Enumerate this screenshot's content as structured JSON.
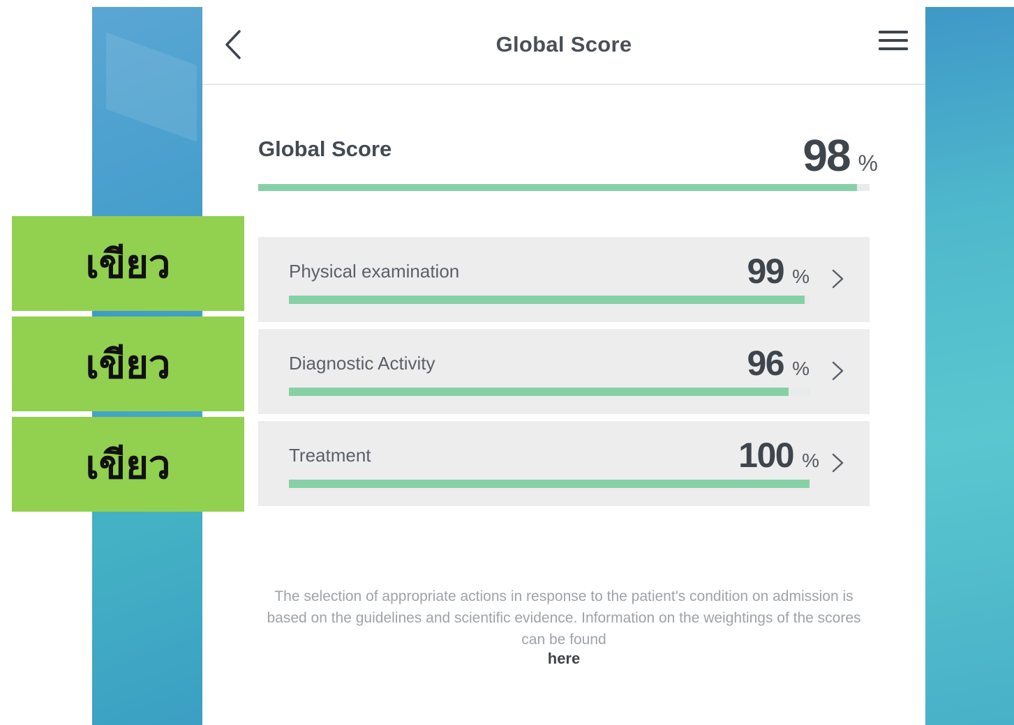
{
  "header": {
    "title": "Global Score",
    "back_icon": "chevron-left-icon",
    "menu_icon": "hamburger-menu-icon"
  },
  "global_score": {
    "label": "Global Score",
    "value": "98",
    "unit": "%",
    "progress_percent": 98
  },
  "categories": [
    {
      "label": "Physical examination",
      "value": "99",
      "unit": "%",
      "progress_percent": 99
    },
    {
      "label": "Diagnostic Activity",
      "value": "96",
      "unit": "%",
      "progress_percent": 96
    },
    {
      "label": "Treatment",
      "value": "100",
      "unit": "%",
      "progress_percent": 100
    }
  ],
  "footer": {
    "note": "The selection of appropriate actions in response to the patient's condition on admission is based on the guidelines and scientific evidence. Information on the weightings of the scores can be found",
    "link_label": "here"
  },
  "overlay_tags": [
    {
      "text": "เขียว"
    },
    {
      "text": "เขียว"
    },
    {
      "text": "เขียว"
    }
  ],
  "colors": {
    "progress_fill": "#86d0a5",
    "progress_track": "#e9eaeb",
    "card_background": "#ededee",
    "tag_background": "#92d050",
    "background_teal": "#4fb9cc"
  }
}
